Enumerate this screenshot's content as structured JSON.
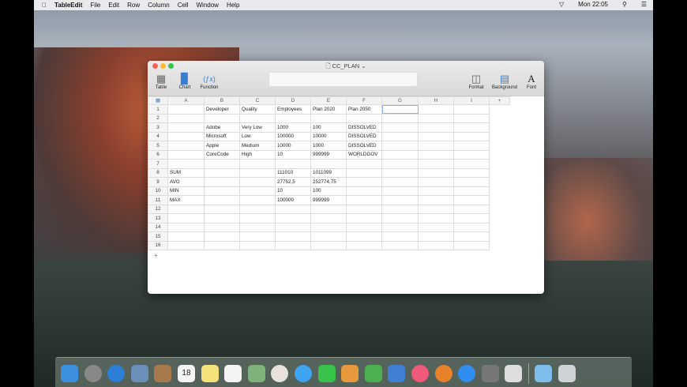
{
  "menubar": {
    "app": "TableEdit",
    "items": [
      "File",
      "Edit",
      "Row",
      "Column",
      "Cell",
      "Window",
      "Help"
    ],
    "clock": "Mon 22:05"
  },
  "window": {
    "title": "CC_PLAN"
  },
  "toolbar": {
    "table": "Table",
    "chart": "Chart",
    "function": "Function",
    "format": "Format",
    "background": "Background",
    "font": "Font"
  },
  "columns": [
    "A",
    "B",
    "C",
    "D",
    "E",
    "F",
    "G",
    "H",
    "I"
  ],
  "add_column": "+",
  "add_row": "+",
  "rows": [
    [
      "1",
      "",
      "Developer",
      "Quality",
      "Employees",
      "Plan 2020",
      "Plan 2050",
      "",
      "",
      ""
    ],
    [
      "2",
      "",
      "",
      "",
      "",
      "",
      "",
      "",
      "",
      ""
    ],
    [
      "3",
      "",
      "Adobe",
      "Very Low",
      "1000",
      "100",
      "DISSOLVED",
      "",
      "",
      ""
    ],
    [
      "4",
      "",
      "Microsoft",
      "Low",
      "100000",
      "10000",
      "DISSOLVED",
      "",
      "",
      ""
    ],
    [
      "5",
      "",
      "Apple",
      "Medium",
      "10000",
      "1000",
      "DISSOLVED",
      "",
      "",
      ""
    ],
    [
      "6",
      "",
      "CoreCode",
      "High",
      "10",
      "999999",
      "WORLDGOV",
      "",
      "",
      ""
    ],
    [
      "7",
      "",
      "",
      "",
      "",
      "",
      "",
      "",
      "",
      ""
    ],
    [
      "8",
      "SUM",
      "",
      "",
      "111010",
      "1011099",
      "",
      "",
      "",
      ""
    ],
    [
      "9",
      "AVG",
      "",
      "",
      "27752,5",
      "252774,75",
      "",
      "",
      "",
      ""
    ],
    [
      "10",
      "MIN",
      "",
      "",
      "10",
      "100",
      "",
      "",
      "",
      ""
    ],
    [
      "11",
      "MAX",
      "",
      "",
      "100000",
      "999999",
      "",
      "",
      "",
      ""
    ],
    [
      "12",
      "",
      "",
      "",
      "",
      "",
      "",
      "",
      "",
      ""
    ],
    [
      "13",
      "",
      "",
      "",
      "",
      "",
      "",
      "",
      "",
      ""
    ],
    [
      "14",
      "",
      "",
      "",
      "",
      "",
      "",
      "",
      "",
      ""
    ],
    [
      "15",
      "",
      "",
      "",
      "",
      "",
      "",
      "",
      "",
      ""
    ],
    [
      "16",
      "",
      "",
      "",
      "",
      "",
      "",
      "",
      "",
      ""
    ]
  ],
  "dock": [
    {
      "name": "finder",
      "color": "#3d8fe0"
    },
    {
      "name": "launchpad",
      "color": "#888"
    },
    {
      "name": "safari",
      "color": "#2b7fd6"
    },
    {
      "name": "mail",
      "color": "#6a8fb8"
    },
    {
      "name": "contacts",
      "color": "#a67a4a"
    },
    {
      "name": "calendar",
      "color": "#f4f4f4",
      "text": "18"
    },
    {
      "name": "notes",
      "color": "#f5e27a"
    },
    {
      "name": "reminders",
      "color": "#f4f4f4"
    },
    {
      "name": "maps",
      "color": "#7fb27a"
    },
    {
      "name": "photos",
      "color": "#e8e2dc"
    },
    {
      "name": "messages",
      "color": "#3ea5f2"
    },
    {
      "name": "facetime",
      "color": "#37c24a"
    },
    {
      "name": "pages",
      "color": "#e79a3c"
    },
    {
      "name": "numbers",
      "color": "#4caf50"
    },
    {
      "name": "keynote",
      "color": "#3f7fd4"
    },
    {
      "name": "itunes",
      "color": "#f05a7a"
    },
    {
      "name": "ibooks",
      "color": "#e8822a"
    },
    {
      "name": "app-store",
      "color": "#2f8ef0"
    },
    {
      "name": "system-preferences",
      "color": "#777"
    },
    {
      "name": "tableedit",
      "color": "#ddd"
    },
    {
      "name": "downloads-folder",
      "color": "#7dbde9"
    },
    {
      "name": "trash",
      "color": "#cfd3d6"
    }
  ]
}
